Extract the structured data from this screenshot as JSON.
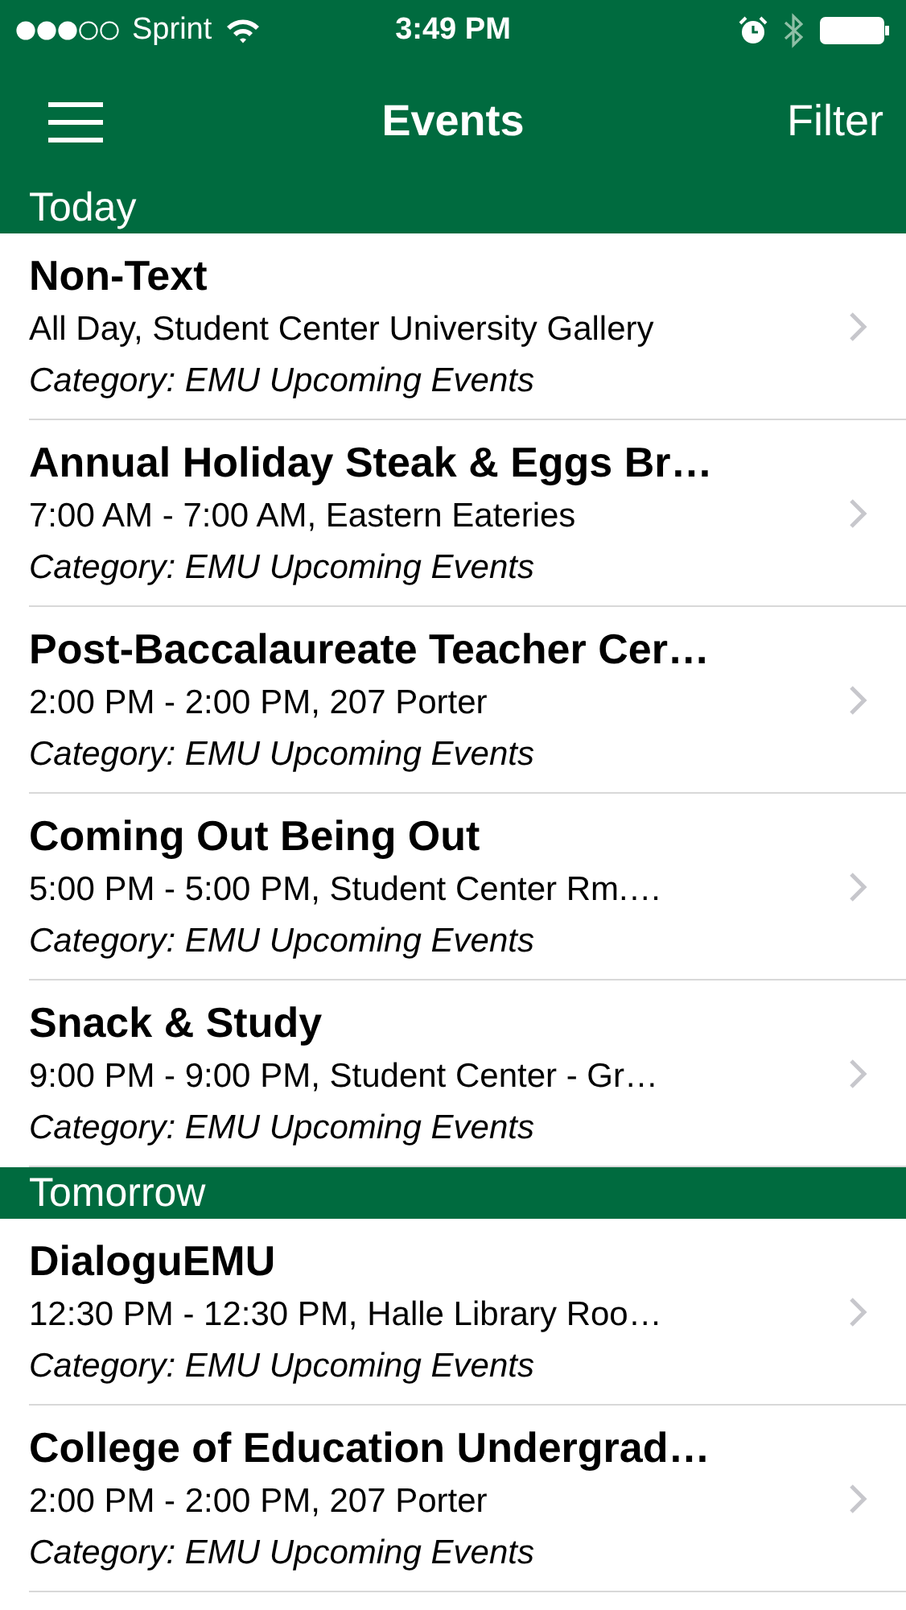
{
  "status_bar": {
    "carrier": "Sprint",
    "time": "3:49 PM"
  },
  "nav": {
    "title": "Events",
    "filter": "Filter"
  },
  "sections": [
    {
      "title": "Today",
      "events": [
        {
          "title": "Non-Text",
          "detail": "All Day, Student Center University Gallery",
          "category": "Category: EMU Upcoming Events"
        },
        {
          "title": "Annual Holiday Steak & Eggs Br…",
          "detail": "7:00 AM - 7:00 AM, Eastern Eateries",
          "category": "Category: EMU Upcoming Events"
        },
        {
          "title": "Post-Baccalaureate Teacher Cer…",
          "detail": "2:00 PM - 2:00 PM, 207 Porter",
          "category": "Category: EMU Upcoming Events"
        },
        {
          "title": "Coming Out Being Out",
          "detail": "5:00 PM - 5:00 PM, Student Center Rm.…",
          "category": "Category: EMU Upcoming Events"
        },
        {
          "title": "Snack & Study",
          "detail": "9:00 PM - 9:00 PM, Student Center - Gr…",
          "category": "Category: EMU Upcoming Events"
        }
      ]
    },
    {
      "title": "Tomorrow",
      "events": [
        {
          "title": "DialoguEMU",
          "detail": "12:30 PM - 12:30 PM, Halle Library Roo…",
          "category": "Category: EMU Upcoming Events"
        },
        {
          "title": "College of Education Undergrad…",
          "detail": "2:00 PM - 2:00 PM, 207 Porter",
          "category": "Category: EMU Upcoming Events"
        }
      ]
    }
  ]
}
